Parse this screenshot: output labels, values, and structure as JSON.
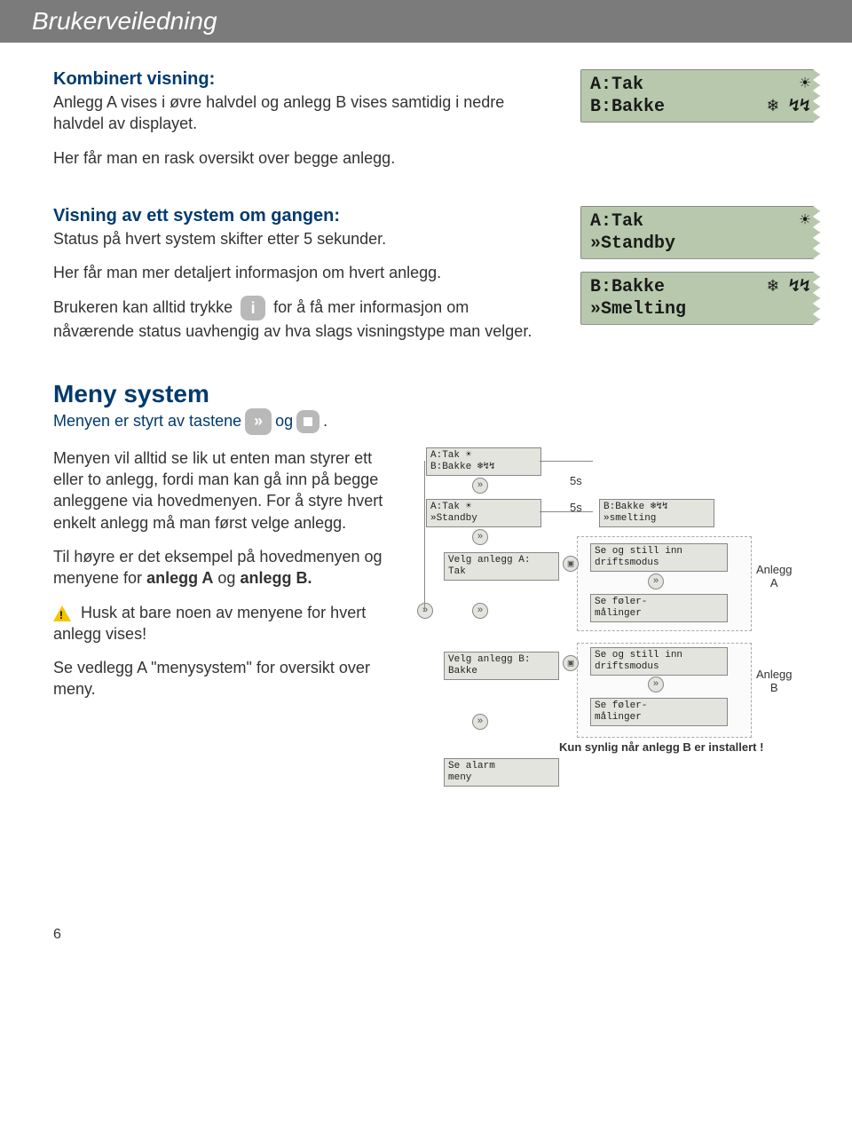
{
  "header": "Brukerveiledning",
  "s1": {
    "title": "Kombinert visning:",
    "p1": "Anlegg A vises i øvre halvdel og anlegg B vises samtidig i nedre halvdel av displayet.",
    "p2": "Her får man en rask oversikt over begge anlegg."
  },
  "s2": {
    "title": "Visning av ett system om gangen:",
    "p1": "Status på hvert system skifter etter 5 sekunder.",
    "p2": "Her får man mer detaljert informasjon om hvert anlegg.",
    "p3_a": "Brukeren kan alltid trykke",
    "p3_b": "for å få mer informasjon om nåværende status uavhengig av hva slags visningstype man velger."
  },
  "disp1": {
    "a_label": "A:Tak",
    "a_sym": "☀",
    "b_label": "B:Bakke",
    "b_sym": "❄ ↯↯"
  },
  "disp2": {
    "a_label": "A:Tak",
    "a_sym": "☀",
    "a_status": "»Standby"
  },
  "disp3": {
    "b_label": "B:Bakke",
    "b_sym": "❄ ↯↯",
    "b_status": "»Smelting"
  },
  "meny": {
    "title": "Meny system",
    "intro_a": "Menyen er styrt av tastene",
    "intro_og": "og",
    "intro_dot": ".",
    "p1": "Menyen vil alltid se lik ut enten man styrer ett eller to anlegg, fordi man kan gå inn på begge anleggene via hovedmenyen. For å styre hvert enkelt anlegg må man først velge anlegg.",
    "p2_a": "Til høyre er det eksempel på hovedmenyen og menyene for ",
    "p2_b": "anlegg A",
    "p2_c": " og ",
    "p2_d": "anlegg B.",
    "warn": "Husk at bare noen av menyene for hvert anlegg vises!",
    "p3": "Se vedlegg A \"menysystem\" for oversikt over meny."
  },
  "diagram": {
    "n1": {
      "l1": "A:Tak         ☀",
      "l2": "B:Bakke      ❄↯↯"
    },
    "n2": {
      "l1": "A:Tak         ☀",
      "l2": "»Standby"
    },
    "n3": {
      "l1": "B:Bakke      ❄↯↯",
      "l2": "»smelting"
    },
    "n4": {
      "l1": "Velg anlegg A:",
      "l2": "Tak"
    },
    "n5": {
      "l1": "Se og still inn",
      "l2": "driftsmodus"
    },
    "n6": {
      "l1": "Se føler-",
      "l2": "målinger"
    },
    "n7": {
      "l1": "Velg anlegg B:",
      "l2": "Bakke"
    },
    "n8": {
      "l1": "Se og still inn",
      "l2": "driftsmodus"
    },
    "n9": {
      "l1": "Se føler-",
      "l2": "målinger"
    },
    "n10": {
      "l1": "Se alarm",
      "l2": "meny"
    },
    "t5s": "5s",
    "anleggA": "Anlegg\nA",
    "anleggB": "Anlegg\nB",
    "footer": "Kun synlig når anlegg B er installert   !"
  },
  "page": "6"
}
